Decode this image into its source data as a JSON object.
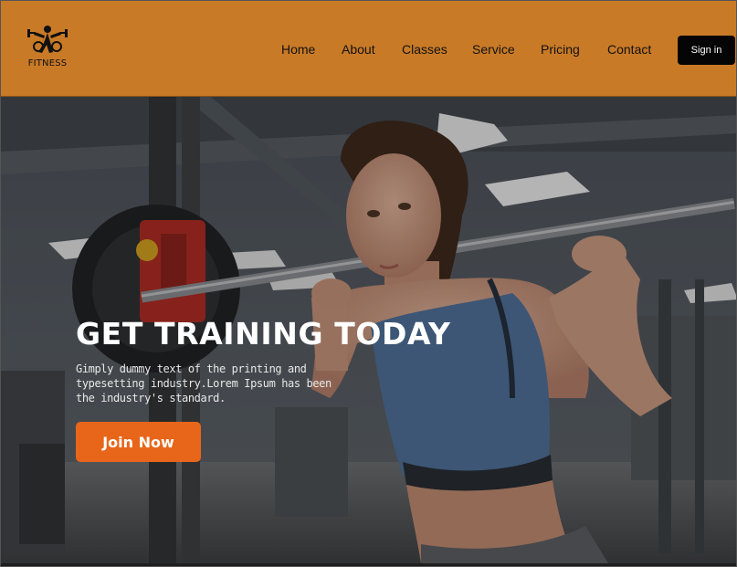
{
  "brand": {
    "logo_text": "FITNESS",
    "color": "#c97a27"
  },
  "nav": {
    "items": [
      {
        "label": "Home"
      },
      {
        "label": "About"
      },
      {
        "label": "Classes"
      },
      {
        "label": "Service"
      },
      {
        "label": "Pricing"
      },
      {
        "label": "Contact"
      }
    ],
    "signin_label": "Sign in"
  },
  "hero": {
    "title": "GET TRAINING TODAY",
    "subtitle": "Gimply dummy text of the printing and typesetting industry.Lorem Ipsum has been the industry's standard.",
    "cta_label": "Join Now",
    "cta_color": "#e8661a",
    "image_icon": "woman-barbell-squat-gym-photo"
  }
}
